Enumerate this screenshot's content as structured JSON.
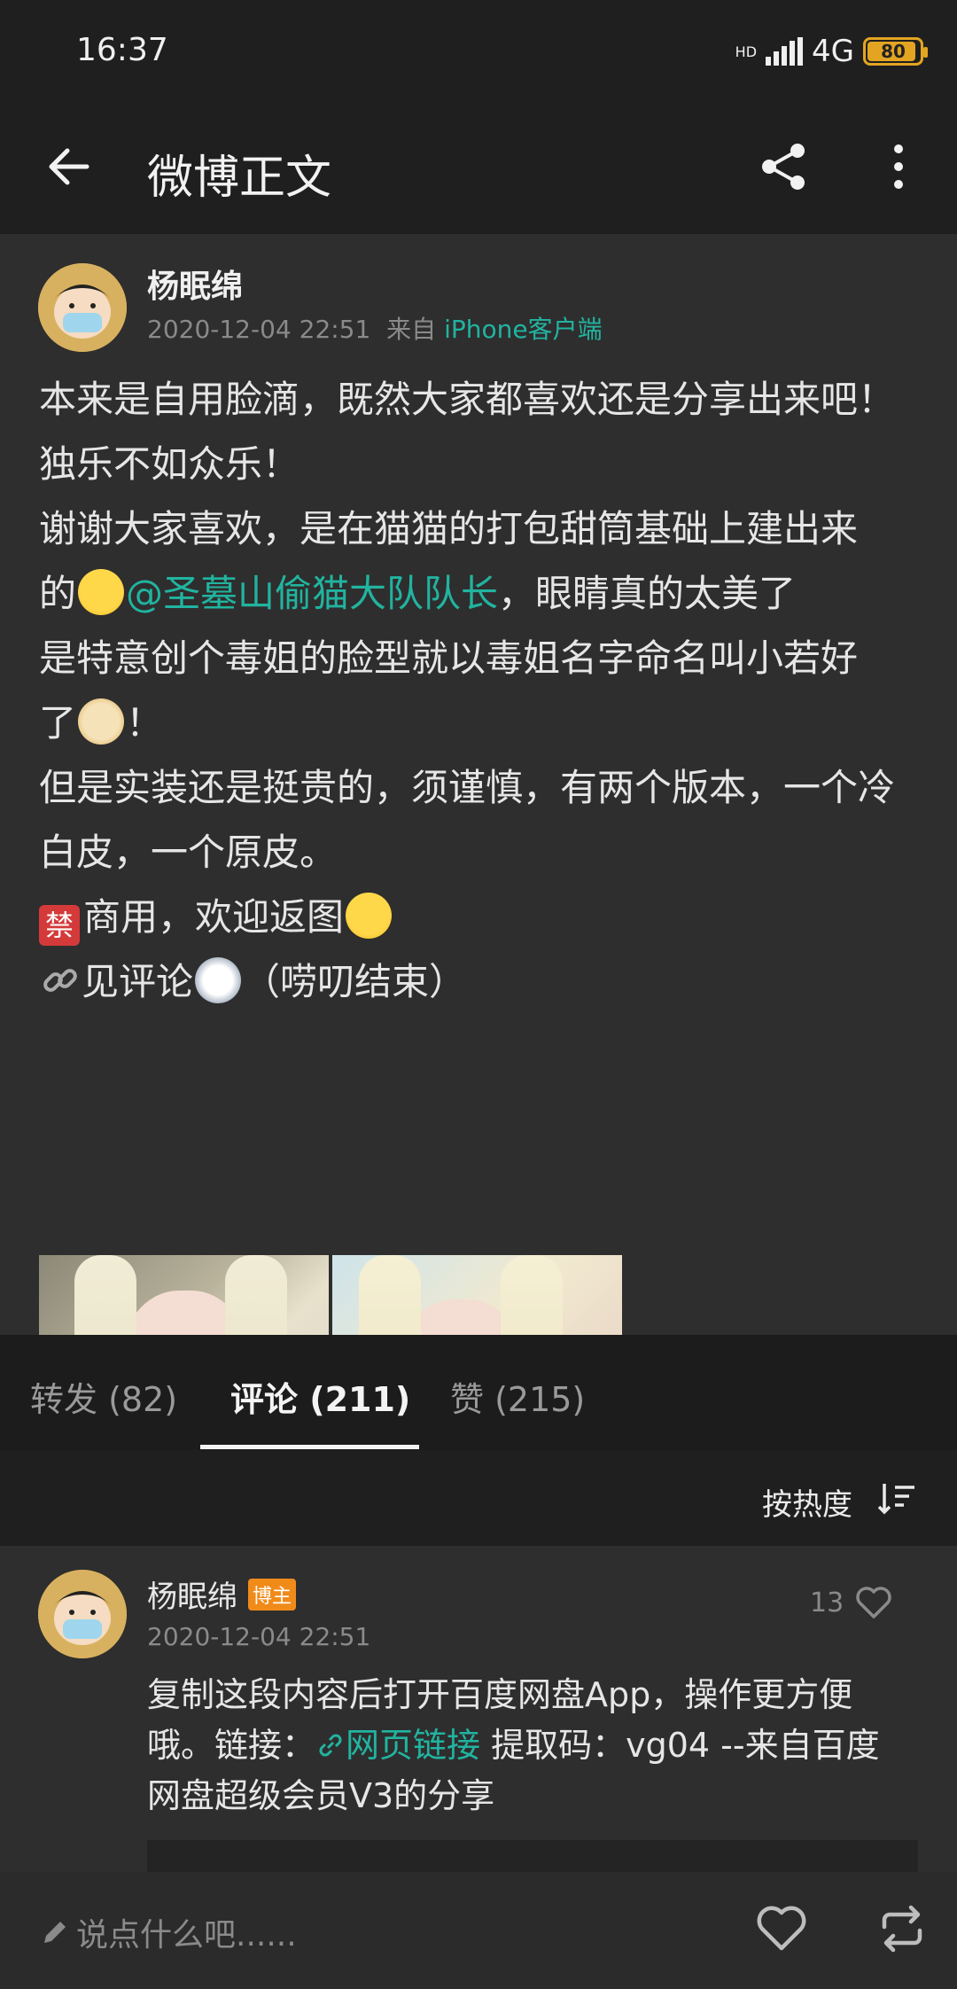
{
  "status": {
    "time": "16:37",
    "network": "4G",
    "hd": "HD",
    "battery": "80"
  },
  "header": {
    "title": "微博正文"
  },
  "post": {
    "author": "杨眠绵",
    "time": "2020-12-04 22:51",
    "from_prefix": "来自",
    "source": "iPhone客户端",
    "lines": {
      "l1": "本来是自用脸滴，既然大家都喜欢还是分享出来吧！",
      "l2": "独乐不如众乐！",
      "l3": "谢谢大家喜欢，是在猫猫的打包甜筒基础上建出来",
      "l4_pre": "的",
      "l4_mention": "@圣墓山偷猫大队队长",
      "l4_post": "，眼睛真的太美了",
      "l5": "是特意创个毒姐的脸型就以毒姐名字命名叫小若好",
      "l6_pre": "了",
      "l6_post": "！",
      "l7": "但是实装还是挺贵的，须谨慎，有两个版本，一个冷",
      "l8": "白皮，一个原皮。",
      "l9_ban": "禁",
      "l9_text": "商用，欢迎返图",
      "l10_text": "见评论",
      "l10_post": "（唠叨结束）"
    }
  },
  "tabs": {
    "repost": "转发 (82)",
    "comments": "评论 (211)",
    "likes": "赞 (215)"
  },
  "sort": {
    "label": "按热度"
  },
  "comment": {
    "author": "杨眠绵",
    "badge": "博主",
    "time": "2020-12-04 22:51",
    "likes": "13",
    "text_1": "复制这段内容后打开百度网盘App，操作更方便",
    "text_2_pre": "哦。链接：",
    "text_2_link": "网页链接",
    "text_2_post": " 提取码：vg04 --来自百度",
    "text_3": "网盘超级会员V3的分享"
  },
  "bottom": {
    "placeholder": "说点什么吧......"
  },
  "colors": {
    "accent": "#21b4a0",
    "badge": "#f08b1a",
    "background": "#262626"
  }
}
